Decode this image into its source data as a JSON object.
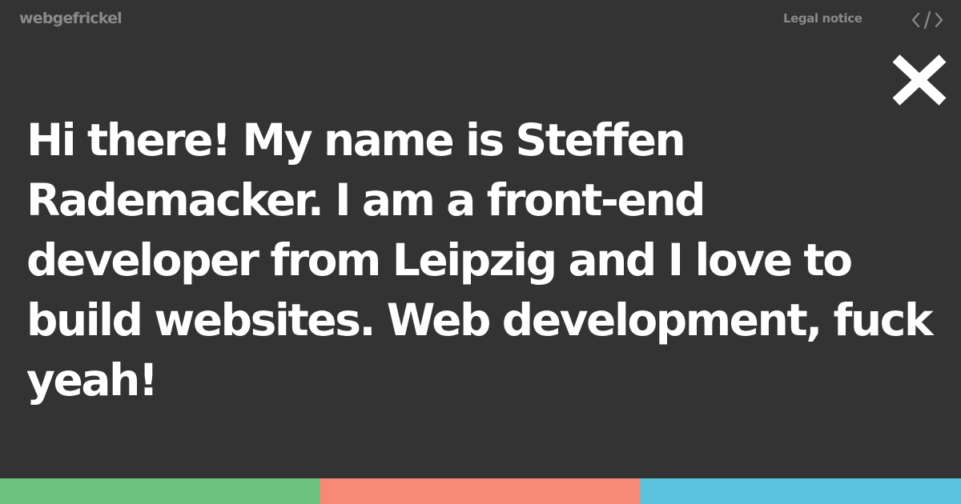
{
  "header": {
    "logo_text": "webgefrickel",
    "legal_notice_label": "Legal notice",
    "code_icon": "code-brackets-icon"
  },
  "overlay": {
    "close_icon": "close-icon"
  },
  "main": {
    "intro_text": "Hi there! My name is Steffen Rademacker. I am a front-end developer from Leipzig and I love to build websites. Web development, fuck yeah!"
  },
  "color_bar": {
    "colors": [
      "#6cc17e",
      "#f78a77",
      "#5bc3dd"
    ]
  },
  "colors": {
    "background": "#333333",
    "text": "#ffffff",
    "muted": "#8a8a8a"
  }
}
